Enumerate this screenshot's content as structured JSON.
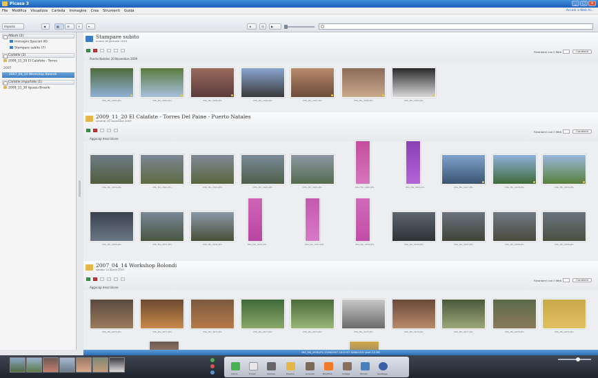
{
  "app": {
    "title": "Picasa 3",
    "window_controls": [
      "_",
      "□",
      "×"
    ]
  },
  "menu": {
    "items": [
      "File",
      "Modifica",
      "Visualizza",
      "Cartella",
      "Immagine",
      "Crea",
      "Strumenti",
      "Guida"
    ],
    "account": "Accedi a Web Al..."
  },
  "toolbar": {
    "import": "Importa",
    "search_placeholder": ""
  },
  "sidebar": {
    "albums_header": "Album (2)",
    "albums": [
      "Immagini Speciali (6)",
      "Stampare subito (7)"
    ],
    "folders_header": "Cartelle (2)",
    "folders": [
      "2009_11_20 El Calafate - Torres"
    ],
    "year": "2007",
    "selected_folder": "2007_04_14 Workshop Bolondi",
    "imported_header": "Cartelle importate (1)",
    "imported": [
      "2009_11_30 Iguazu Brasile"
    ]
  },
  "sections": [
    {
      "title": "Stampare subito",
      "date": "lunedì 18 gennaio 2010",
      "caption": "Puerto Natales 20 Novembre 2009",
      "sort_label": "Ricordami con il Web",
      "share_label": "Condividi"
    },
    {
      "title": "2009_11_20 El Calafate - Torres Del Paine - Puerto Natales",
      "date": "venerdì 20 novembre 2009",
      "caption": "Aggiungi descrizione",
      "sort_label": "Ricordami con il Web",
      "share_label": "Condividi"
    },
    {
      "title": "2007_04_14 Workshop Bolondi",
      "date": "sabato 14 aprile 2007",
      "caption": "Aggiungi descrizione",
      "sort_label": "Ricordami con il Web",
      "share_label": "Condividi"
    }
  ],
  "thumb_labels": {
    "r1": [
      "IMG_MG_4993.JPG",
      "IMG_MG_4994.JPG",
      "IMG_MG_4995.JPG",
      "IMG_MG_4996.JPG",
      "IMG_MG_4997.JPG",
      "IMG_MG_4998.JPG",
      "IMG_MG_4999.JPG"
    ],
    "r2": [
      "IMG_MG_4920.JPG",
      "IMG_MG_4921.JPG",
      "IMG_MG_4922.JPG",
      "IMG_MG_4923.JPG",
      "IMG_MG_4924.JPG",
      "IMG_MG_4925.JPG",
      "IMG_MG_4926.JPG",
      "IMG_MG_4927.JPG",
      "IMG_MG_4928.JPG",
      "IMG_MG_4929.JPG"
    ],
    "r3": [
      "IMG_MG_4930.JPG",
      "IMG_MG_4931.JPG",
      "IMG_MG_4932.JPG",
      "IMG_MG_4933.JPG",
      "IMG_MG_4934.JPG",
      "IMG_MG_4935.JPG",
      "IMG_MG_4936.JPG",
      "IMG_MG_4937.JPG",
      "IMG_MG_4938.JPG",
      "IMG_MG_4939.JPG"
    ],
    "r4": [
      "IMG_MG_4670.JPG",
      "IMG_MG_4671.JPG",
      "IMG_MG_4672.JPG",
      "IMG_MG_4673.JPG",
      "IMG_MG_4674.JPG",
      "IMG_MG_4675.JPG",
      "IMG_MG_4676.JPG",
      "IMG_MG_4677.JPG",
      "IMG_MG_4678.JPG",
      "IMG_MG_4679.JPG"
    ]
  },
  "status": "IMG_MG_4936.JPG   15/04/2007 16:22:07   3648x2432 pixel   3,5 MB",
  "tray_buttons": [
    "Carica",
    "E-mail",
    "Stampa",
    "Esporta",
    "Acquista",
    "BlogThis!",
    "Collage",
    "Filmato",
    "Geotagga"
  ],
  "colors": {
    "accent": "#2d6fb8",
    "folder": "#e3b849",
    "album": "#3b7cc4"
  }
}
